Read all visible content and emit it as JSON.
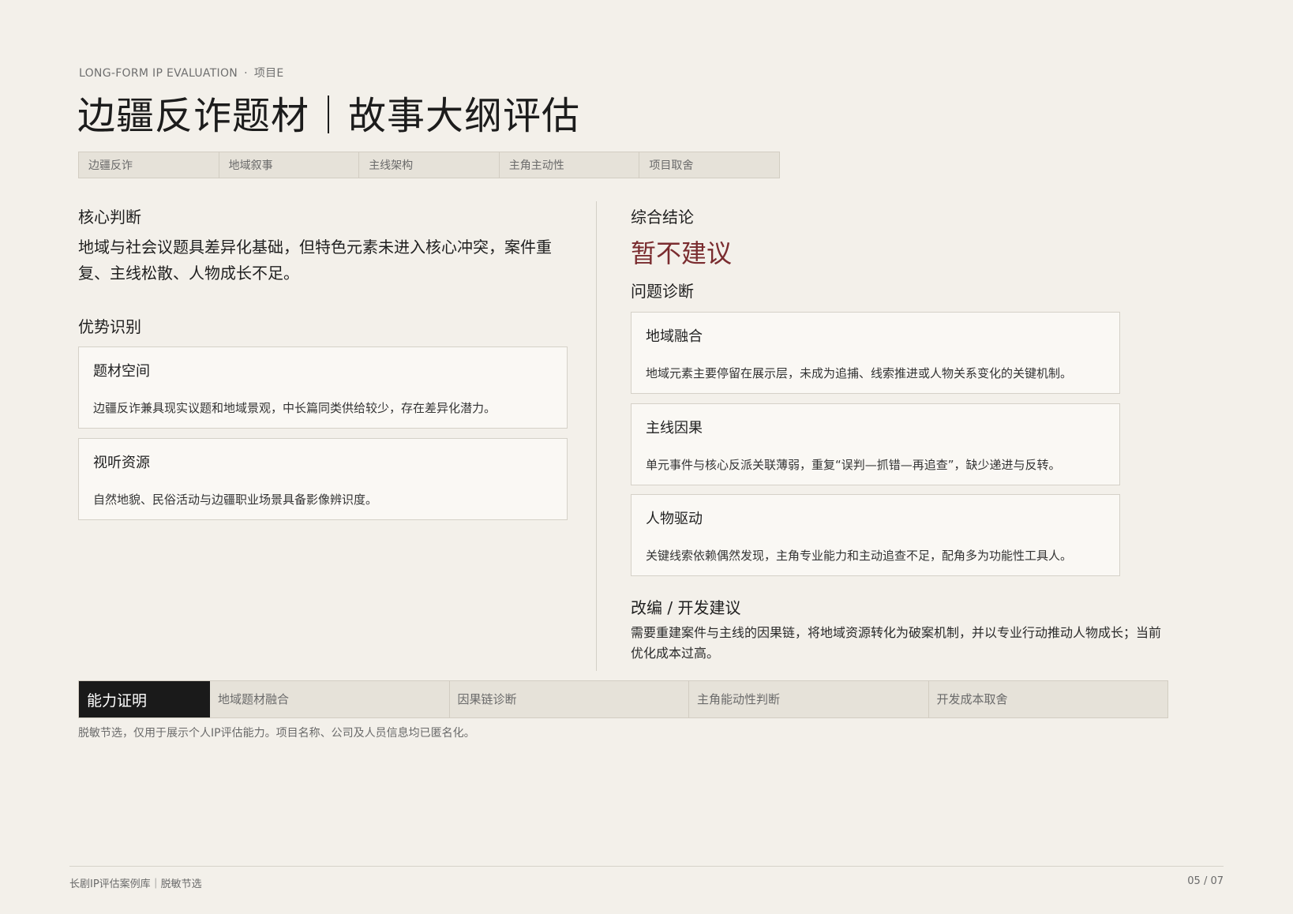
{
  "header": {
    "eyebrow_label": "LONG-FORM IP EVALUATION",
    "eyebrow_sep": "·",
    "project": "项目E",
    "title": "边疆反诈题材｜故事大纲评估",
    "tags": [
      "边疆反诈",
      "地域叙事",
      "主线架构",
      "主角主动性",
      "项目取舍"
    ]
  },
  "left": {
    "core_heading": "核心判断",
    "core_text": "地域与社会议题具差异化基础，但特色元素未进入核心冲突，案件重复、主线松散、人物成长不足。",
    "strengths_heading": "优势识别",
    "strengths": [
      {
        "title": "题材空间",
        "body": "边疆反诈兼具现实议题和地域景观，中长篇同类供给较少，存在差异化潜力。"
      },
      {
        "title": "视听资源",
        "body": "自然地貌、民俗活动与边疆职业场景具备影像辨识度。"
      }
    ]
  },
  "right": {
    "conclusion_heading": "综合结论",
    "verdict": "暂不建议",
    "diagnosis_heading": "问题诊断",
    "issues": [
      {
        "title": "地域融合",
        "body": "地域元素主要停留在展示层，未成为追捕、线索推进或人物关系变化的关键机制。"
      },
      {
        "title": "主线因果",
        "body": "单元事件与核心反派关联薄弱，重复“误判—抓错—再追查”，缺少递进与反转。"
      },
      {
        "title": "人物驱动",
        "body": "关键线索依赖偶然发现，主角专业能力和主动追查不足，配角多为功能性工具人。"
      }
    ],
    "advice_heading": "改编 / 开发建议",
    "advice_text": "需要重建案件与主线的因果链，将地域资源转化为破案机制，并以专业行动推动人物成长；当前优化成本过高。"
  },
  "capability": {
    "label": "能力证明",
    "items": [
      "地域题材融合",
      "因果链诊断",
      "主角能动性判断",
      "开发成本取舍"
    ],
    "note": "脱敏节选，仅用于展示个人IP评估能力。项目名称、公司及人员信息均已匿名化。"
  },
  "footer": {
    "left": "长剧IP评估案例库｜脱敏节选",
    "page": "05 / 07"
  },
  "colors": {
    "background": "#f3f0ea",
    "verdict": "#7a2c2f",
    "capability_label_bg": "#1a1a1a"
  }
}
